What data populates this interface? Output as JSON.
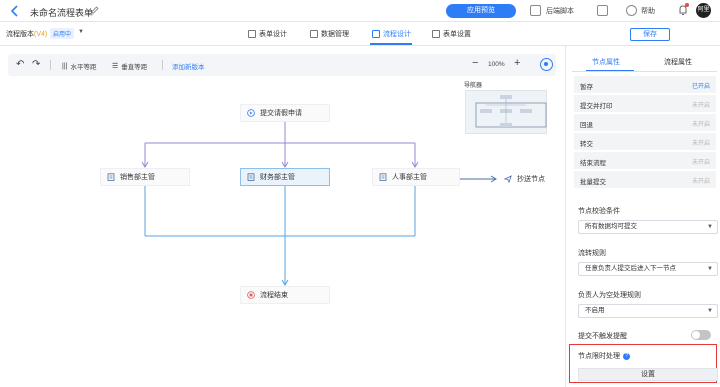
{
  "topbar": {
    "title": "未命名流程表单",
    "primary_button": "应用预览",
    "backend_label": "后端脚本",
    "help_label": "帮助",
    "avatar_text": "阿里"
  },
  "subbar": {
    "version_label": "流程版本",
    "version_num": "(V4)",
    "status": "启用中",
    "tabs": [
      {
        "label": "表单设计"
      },
      {
        "label": "数据管理"
      },
      {
        "label": "流程设计"
      },
      {
        "label": "表单设置"
      }
    ],
    "save_label": "保存"
  },
  "canvas_toolbar": {
    "horizontal_spacing": "水平等距",
    "vertical_spacing": "垂直等距",
    "add_version": "添加新版本",
    "zoom": "100%"
  },
  "navigator": {
    "title": "导航器"
  },
  "nodes": {
    "submit": "提交请假申请",
    "sales": "销售部主管",
    "finance": "财务部主管",
    "hr": "人事部主管",
    "cc": "抄送节点",
    "end": "流程结束"
  },
  "panel": {
    "tabs": [
      "节点属性",
      "流程属性"
    ],
    "rows": [
      {
        "label": "暂存",
        "value": "已开启",
        "on": true
      },
      {
        "label": "提交并打印",
        "value": "未开启",
        "on": false
      },
      {
        "label": "回退",
        "value": "未开启",
        "on": false
      },
      {
        "label": "转交",
        "value": "未开启",
        "on": false
      },
      {
        "label": "结束流程",
        "value": "未开启",
        "on": false
      },
      {
        "label": "批量提交",
        "value": "未开启",
        "on": false
      }
    ],
    "validation_label": "节点校验条件",
    "validation_value": "所有数据均可提交",
    "flow_rule_label": "流转规则",
    "flow_rule_value": "任意负责人提交后进入下一节点",
    "empty_rule_label": "负责人为空处理规则",
    "empty_rule_value": "不启用",
    "no_reminder_label": "提交不触发提醒",
    "timeout_label": "节点限时处理",
    "set_button": "设置"
  },
  "colors": {
    "accent": "#2f7df6",
    "highlight": "#e53935",
    "flow_line_purple": "#9a86d6",
    "flow_line_blue": "#5aa3e0"
  }
}
